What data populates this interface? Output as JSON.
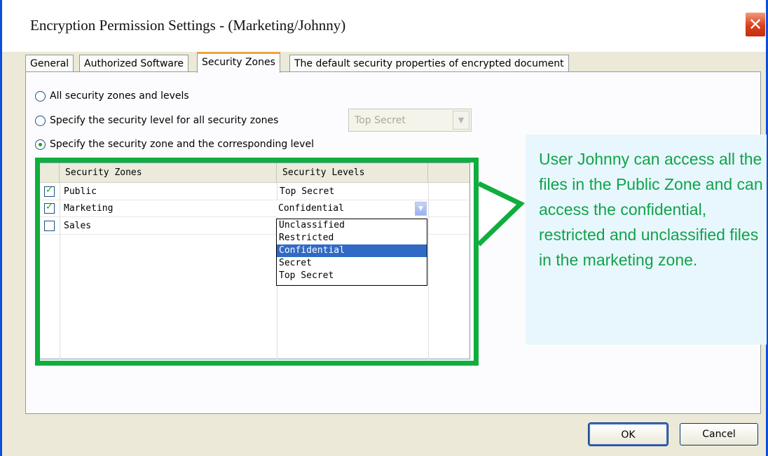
{
  "window": {
    "title": "Encryption Permission Settings  -  (Marketing/Johnny)",
    "close_glyph": "✕"
  },
  "tabs": [
    {
      "label": "General"
    },
    {
      "label": "Authorized Software"
    },
    {
      "label": "Security Zones",
      "active": true
    },
    {
      "label": "The default security properties of encrypted document"
    }
  ],
  "options": {
    "all": "All security zones and levels",
    "specify_level": "Specify the security level for all security zones",
    "specify_zone": "Specify the security zone and the corresponding level",
    "selected": "specify_zone",
    "level_select_value": "Top Secret"
  },
  "grid": {
    "headers": [
      "Security Zones",
      "Security Levels"
    ],
    "rows": [
      {
        "zone": "Public",
        "level": "Top Secret",
        "checked": true
      },
      {
        "zone": "Marketing",
        "level": "Confidential",
        "checked": true
      },
      {
        "zone": "Sales",
        "level": "",
        "checked": false
      }
    ],
    "dropdown_options": [
      "Unclassified",
      "Restricted",
      "Confidential",
      "Secret",
      "Top Secret"
    ],
    "dropdown_selected": "Confidential"
  },
  "callout": {
    "text": "User Johnny can access all the files in the Public Zone and can access the confidential, restricted and unclassified files in the marketing zone."
  },
  "buttons": {
    "ok": "OK",
    "cancel": "Cancel"
  },
  "colors": {
    "highlight": "#0fae3d",
    "callout_bg": "#e8f7fd",
    "callout_text": "#10a34b",
    "selection": "#316ac5"
  }
}
